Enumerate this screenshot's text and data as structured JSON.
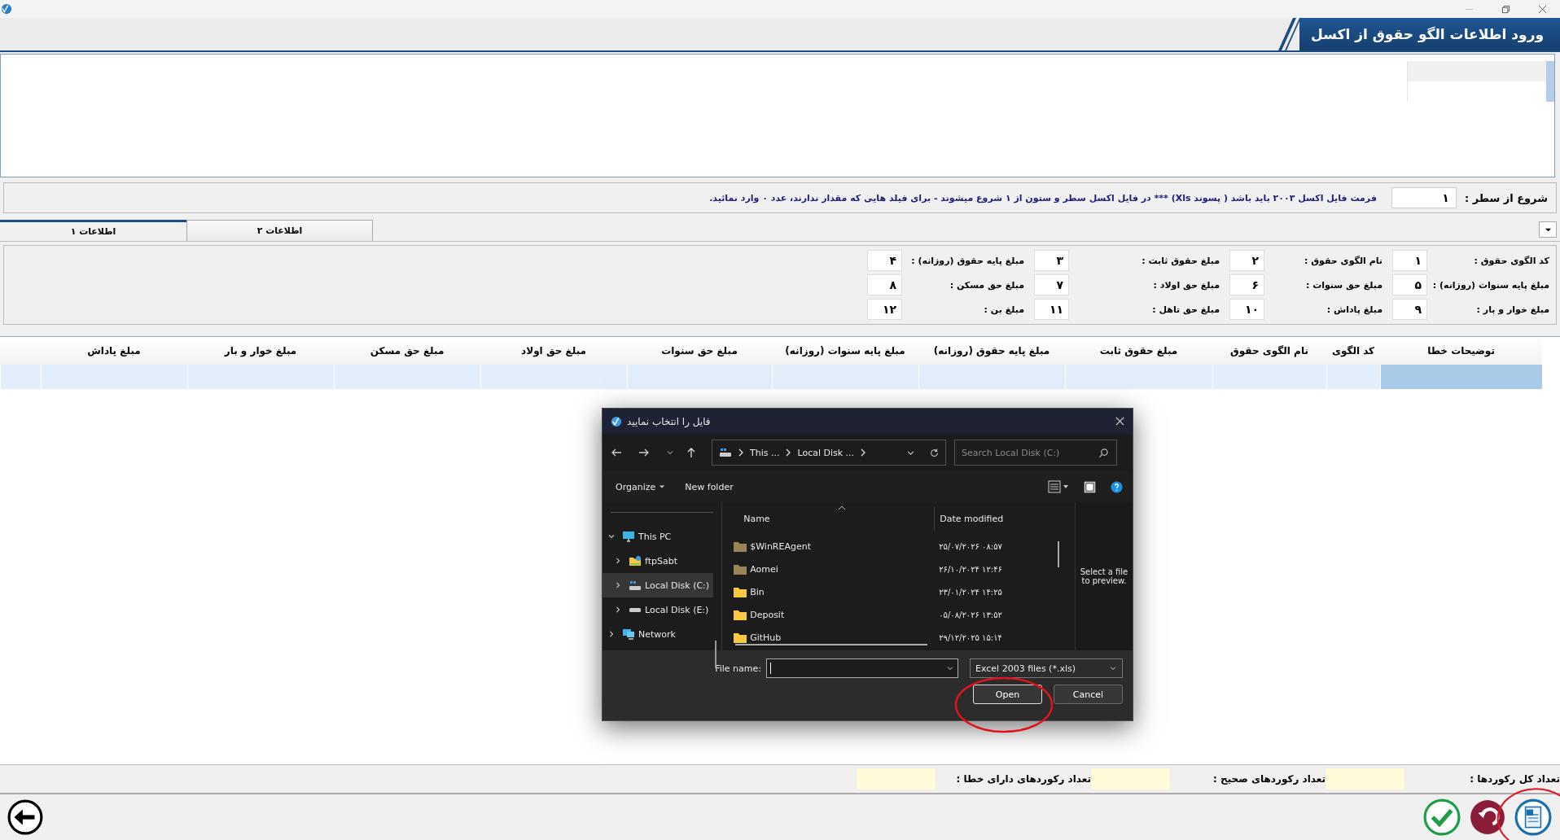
{
  "window": {
    "title": "ورود اطلاعات الگو حقوق از اکسل"
  },
  "start_row": {
    "label": "شروع از سطر :",
    "value": "۱"
  },
  "note": "فرمت فایل اکسل ۲۰۰۳ باید باشد ( پسوند Xls)  ***  در فایل اکسل سطر و ستون از ۱ شروع میشوند - برای فیلد هایی که مقدار ندارند، عدد ۰ وارد نمائید.",
  "tabs": [
    {
      "label": "اطلاعات ۲",
      "selected": false
    },
    {
      "label": "اطلاعات ۱",
      "selected": true
    }
  ],
  "fields": [
    {
      "label": "کد الگوی حقوق :",
      "value": "۱"
    },
    {
      "label": "نام الگوی حقوق :",
      "value": "۲"
    },
    {
      "label": "مبلغ حقوق ثابت :",
      "value": "۳"
    },
    {
      "label": "مبلغ پایه حقوق (روزانه) :",
      "value": "۴"
    },
    {
      "label": "مبلغ پایه سنوات (روزانه) :",
      "value": "۵"
    },
    {
      "label": "مبلغ حق سنوات :",
      "value": "۶"
    },
    {
      "label": "مبلغ حق اولاد :",
      "value": "۷"
    },
    {
      "label": "مبلغ حق مسکن :",
      "value": "۸"
    },
    {
      "label": "مبلغ خوار و بار :",
      "value": "۹"
    },
    {
      "label": "مبلغ پاداش :",
      "value": "۱۰"
    },
    {
      "label": "مبلغ حق تاهل :",
      "value": "۱۱"
    },
    {
      "label": "مبلغ بن :",
      "value": "۱۲"
    }
  ],
  "table": {
    "columns": [
      "توضیحات خطا",
      "کد الگوی",
      "نام الگوی حقوق",
      "مبلغ حقوق ثابت",
      "مبلغ پایه حقوق (روزانه)",
      "مبلغ پایه سنوات (روزانه)",
      "مبلغ حق سنوات",
      "مبلغ حق اولاد",
      "مبلغ حق مسکن",
      "مبلغ خوار و بار",
      "مبلغ پاداش"
    ],
    "rows": [
      {
        "selected": true
      }
    ]
  },
  "totals": [
    {
      "label": "تعداد کل رکوردها :"
    },
    {
      "label": "تعداد رکوردهای صحیح :"
    },
    {
      "label": "تعداد رکوردهای دارای خطا :"
    }
  ],
  "dialog": {
    "title": "فایل را انتخاب نمایید",
    "breadcrumb": {
      "parent": "This ...",
      "current": "Local Disk ..."
    },
    "search": {
      "placeholder": "Search Local Disk (C:)"
    },
    "toolbar": {
      "organize": "Organize",
      "new_folder": "New folder"
    },
    "nav": [
      {
        "label": "This PC",
        "kind": "pc",
        "expanded": true,
        "selected": false,
        "children": [
          {
            "label": "ftpSabt",
            "kind": "shared",
            "expanded": false,
            "selected": false
          },
          {
            "label": "Local Disk (C:)",
            "kind": "system-drive",
            "expanded": false,
            "selected": true
          },
          {
            "label": "Local Disk (E:)",
            "kind": "drive",
            "expanded": false,
            "selected": false
          }
        ]
      },
      {
        "label": "Network",
        "kind": "network",
        "expanded": false,
        "selected": false
      }
    ],
    "columns": {
      "name": "Name",
      "date_modified": "Date modified"
    },
    "files": [
      {
        "name": "$WinREAgent",
        "date": "۲۵/۰۷/۲۰۲۶ ۰۸:۵۷",
        "hidden": true
      },
      {
        "name": "Aomei",
        "date": "۲۶/۱۰/۲۰۲۴ ۱۲:۴۶",
        "hidden": true
      },
      {
        "name": "Bin",
        "date": "۲۳/۰۱/۲۰۲۴ ۱۴:۲۵",
        "hidden": false
      },
      {
        "name": "Deposit",
        "date": "۰۵/۰۸/۲۰۲۶ ۱۳:۵۲",
        "hidden": false
      },
      {
        "name": "GitHub",
        "date": "۲۹/۱۲/۲۰۲۵ ۱۵:۱۴",
        "hidden": false
      }
    ],
    "preview_hint": "Select a file to preview.",
    "file_name": {
      "label": "File name:"
    },
    "file_type": "Excel 2003 files (*.xls)",
    "open_button": {
      "label": "Open"
    },
    "cancel_button": {
      "label": "Cancel"
    }
  }
}
